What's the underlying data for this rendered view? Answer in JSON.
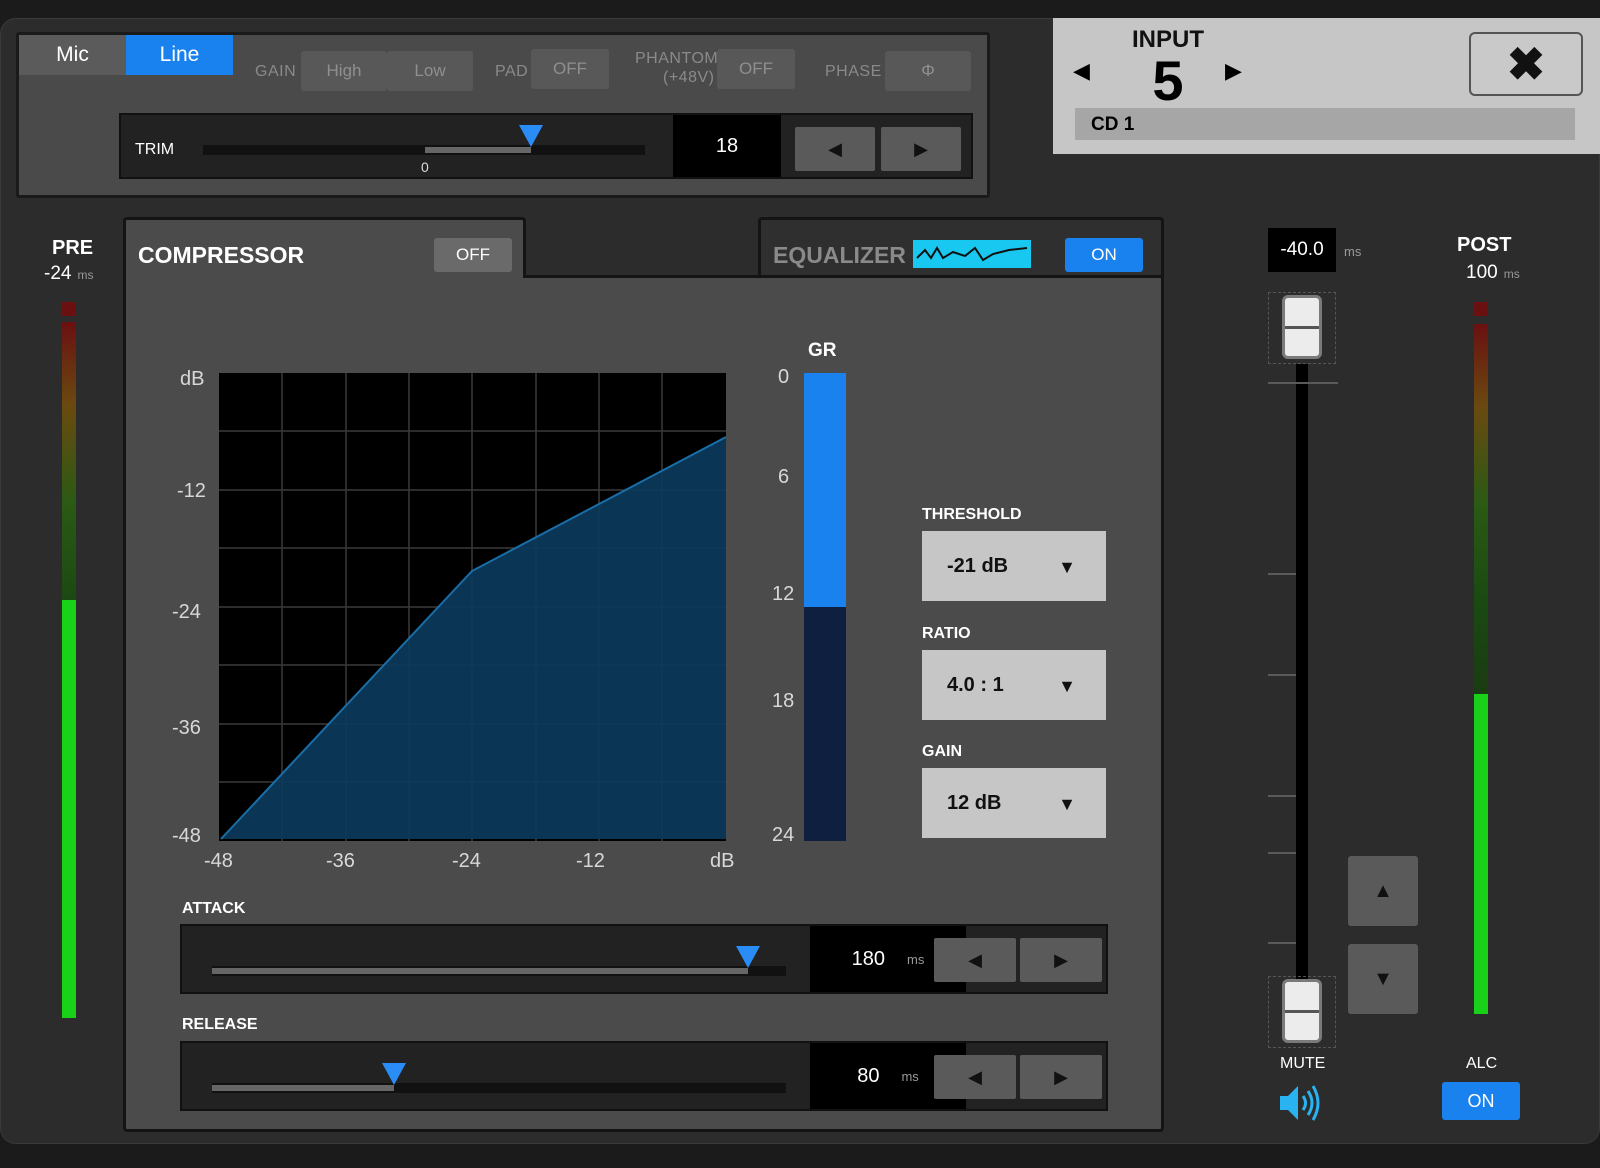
{
  "input_mode": {
    "mic_label": "Mic",
    "line_label": "Line"
  },
  "gain": {
    "label": "GAIN",
    "high": "High",
    "low": "Low"
  },
  "pad": {
    "label": "PAD",
    "value": "OFF"
  },
  "phantom": {
    "label_line1": "PHANTOM",
    "label_line2": "(+48V)",
    "value": "OFF"
  },
  "phase": {
    "label": "PHASE",
    "symbol": "Φ"
  },
  "trim": {
    "label": "TRIM",
    "zero_label": "0",
    "value": "18",
    "left_icon": "◀",
    "right_icon": "▶"
  },
  "header": {
    "title": "INPUT",
    "channel": "5",
    "prev_icon": "◀",
    "next_icon": "▶",
    "name": "CD 1",
    "close_icon": "✖"
  },
  "pre_meter": {
    "title": "PRE",
    "value": "-24",
    "unit": "ms"
  },
  "post_meter": {
    "title": "POST",
    "value": "100",
    "unit": "ms"
  },
  "compressor": {
    "title": "COMPRESSOR",
    "state": "OFF",
    "graph": {
      "y_unit": "dB",
      "y_ticks": [
        "-12",
        "-24",
        "-36",
        "-48"
      ],
      "x_ticks": [
        "-48",
        "-36",
        "-24",
        "-12",
        "dB"
      ]
    },
    "gr": {
      "label": "GR",
      "ticks": [
        "0",
        "6",
        "12",
        "18",
        "24"
      ],
      "level": 12
    },
    "threshold": {
      "label": "THRESHOLD",
      "value": "-21 dB"
    },
    "ratio": {
      "label": "RATIO",
      "value": "4.0 : 1"
    },
    "gain": {
      "label": "GAIN",
      "value": "12 dB"
    },
    "caret": "▼",
    "attack": {
      "label": "ATTACK",
      "value": "180",
      "unit": "ms"
    },
    "release": {
      "label": "RELEASE",
      "value": "80",
      "unit": "ms"
    }
  },
  "equalizer": {
    "title": "EQUALIZER",
    "state": "ON"
  },
  "fader": {
    "value": "-40.0",
    "unit": "ms",
    "up_icon": "▲",
    "down_icon": "▼"
  },
  "mute": {
    "label": "MUTE",
    "icon": "speaker-icon"
  },
  "alc": {
    "label": "ALC",
    "state": "ON"
  },
  "colors": {
    "accent": "#1a82ee",
    "meter_green": "#19d119",
    "eq_cyan": "#18c8f0",
    "graph_fill": "#0c3a5c"
  }
}
